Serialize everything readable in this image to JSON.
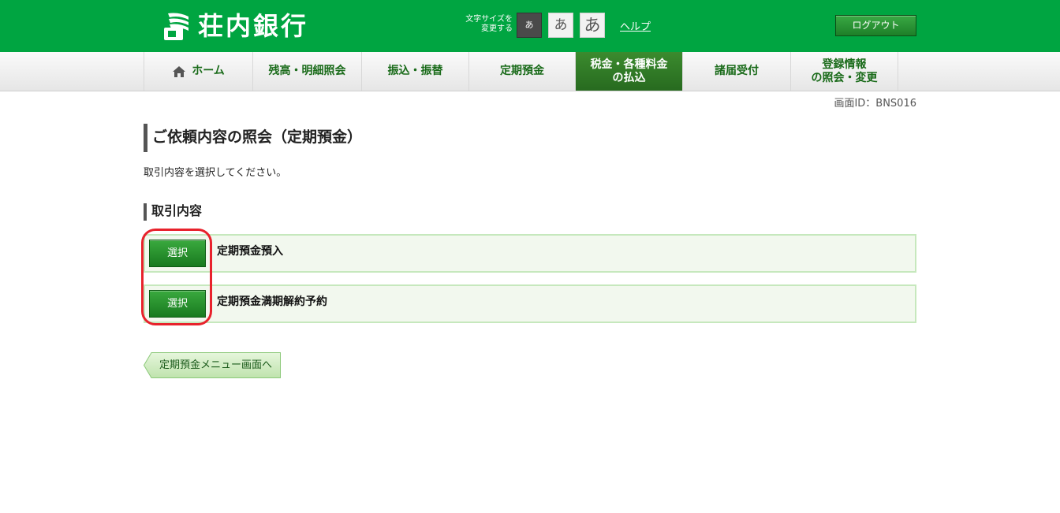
{
  "header": {
    "brand_name": "荘内銀行",
    "font_size_label_line1": "文字サイズを",
    "font_size_label_line2": "変更する",
    "font_small": "あ",
    "font_medium": "あ",
    "font_large": "あ",
    "help_label": "ヘルプ",
    "logout_label": "ログアウト"
  },
  "nav": {
    "items": [
      {
        "label": "ホーム"
      },
      {
        "label": "残高・明細照会"
      },
      {
        "label": "振込・振替"
      },
      {
        "label": "定期預金"
      },
      {
        "label_line1": "税金・各種料金",
        "label_line2": "の払込",
        "active": true
      },
      {
        "label": "諸届受付"
      },
      {
        "label_line1": "登録情報",
        "label_line2": "の照会・変更"
      }
    ]
  },
  "screen_id": "画面ID：BNS016",
  "main": {
    "title": "ご依頼内容の照会（定期預金）",
    "instruction": "取引内容を選択してください。",
    "section_title": "取引内容",
    "transactions": [
      {
        "button_label": "選択",
        "label": "定期預金預入"
      },
      {
        "button_label": "選択",
        "label": "定期預金満期解約予約"
      }
    ],
    "back_button_label": "定期預金メニュー画面へ"
  },
  "colors": {
    "header_green": "#00a541",
    "nav_active": "#2f7a25",
    "row_bg": "#f2f8ee",
    "row_border": "#c6e8bd",
    "highlight": "#e8222c"
  }
}
